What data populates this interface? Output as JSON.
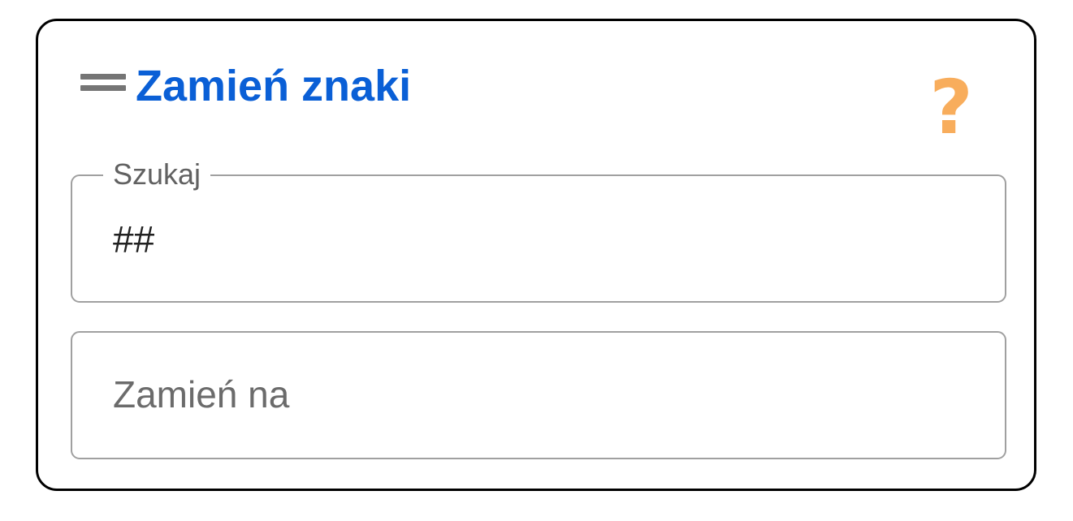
{
  "panel": {
    "title": "Zamień znaki",
    "help_icon": "question-mark-icon",
    "help_color": "#f8ad5c",
    "title_color": "#0a5fd6"
  },
  "search_field": {
    "label": "Szukaj",
    "value": "##"
  },
  "replace_field": {
    "placeholder": "Zamień na",
    "value": ""
  }
}
